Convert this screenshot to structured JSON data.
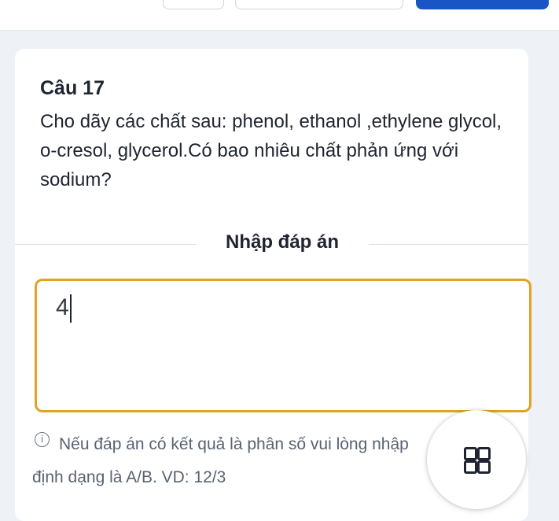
{
  "question": {
    "number_label": "Câu 17",
    "text": "Cho dãy các chất sau: phenol, ethanol ,ethylene glycol, o-cresol, glycerol.Có bao nhiêu chất phản ứng với sodium?"
  },
  "answer_section": {
    "label": "Nhập đáp án",
    "input_value": "4"
  },
  "hint": {
    "icon": "info-icon",
    "text": "Nếu đáp án có kết quả là phân số vui lòng nhập định dạng là A/B. VD: 12/3"
  },
  "fab": {
    "icon": "grid-menu-icon"
  },
  "colors": {
    "accent_border": "#e0a323",
    "primary_blue": "#1a55c5",
    "background": "#eef1f6"
  }
}
